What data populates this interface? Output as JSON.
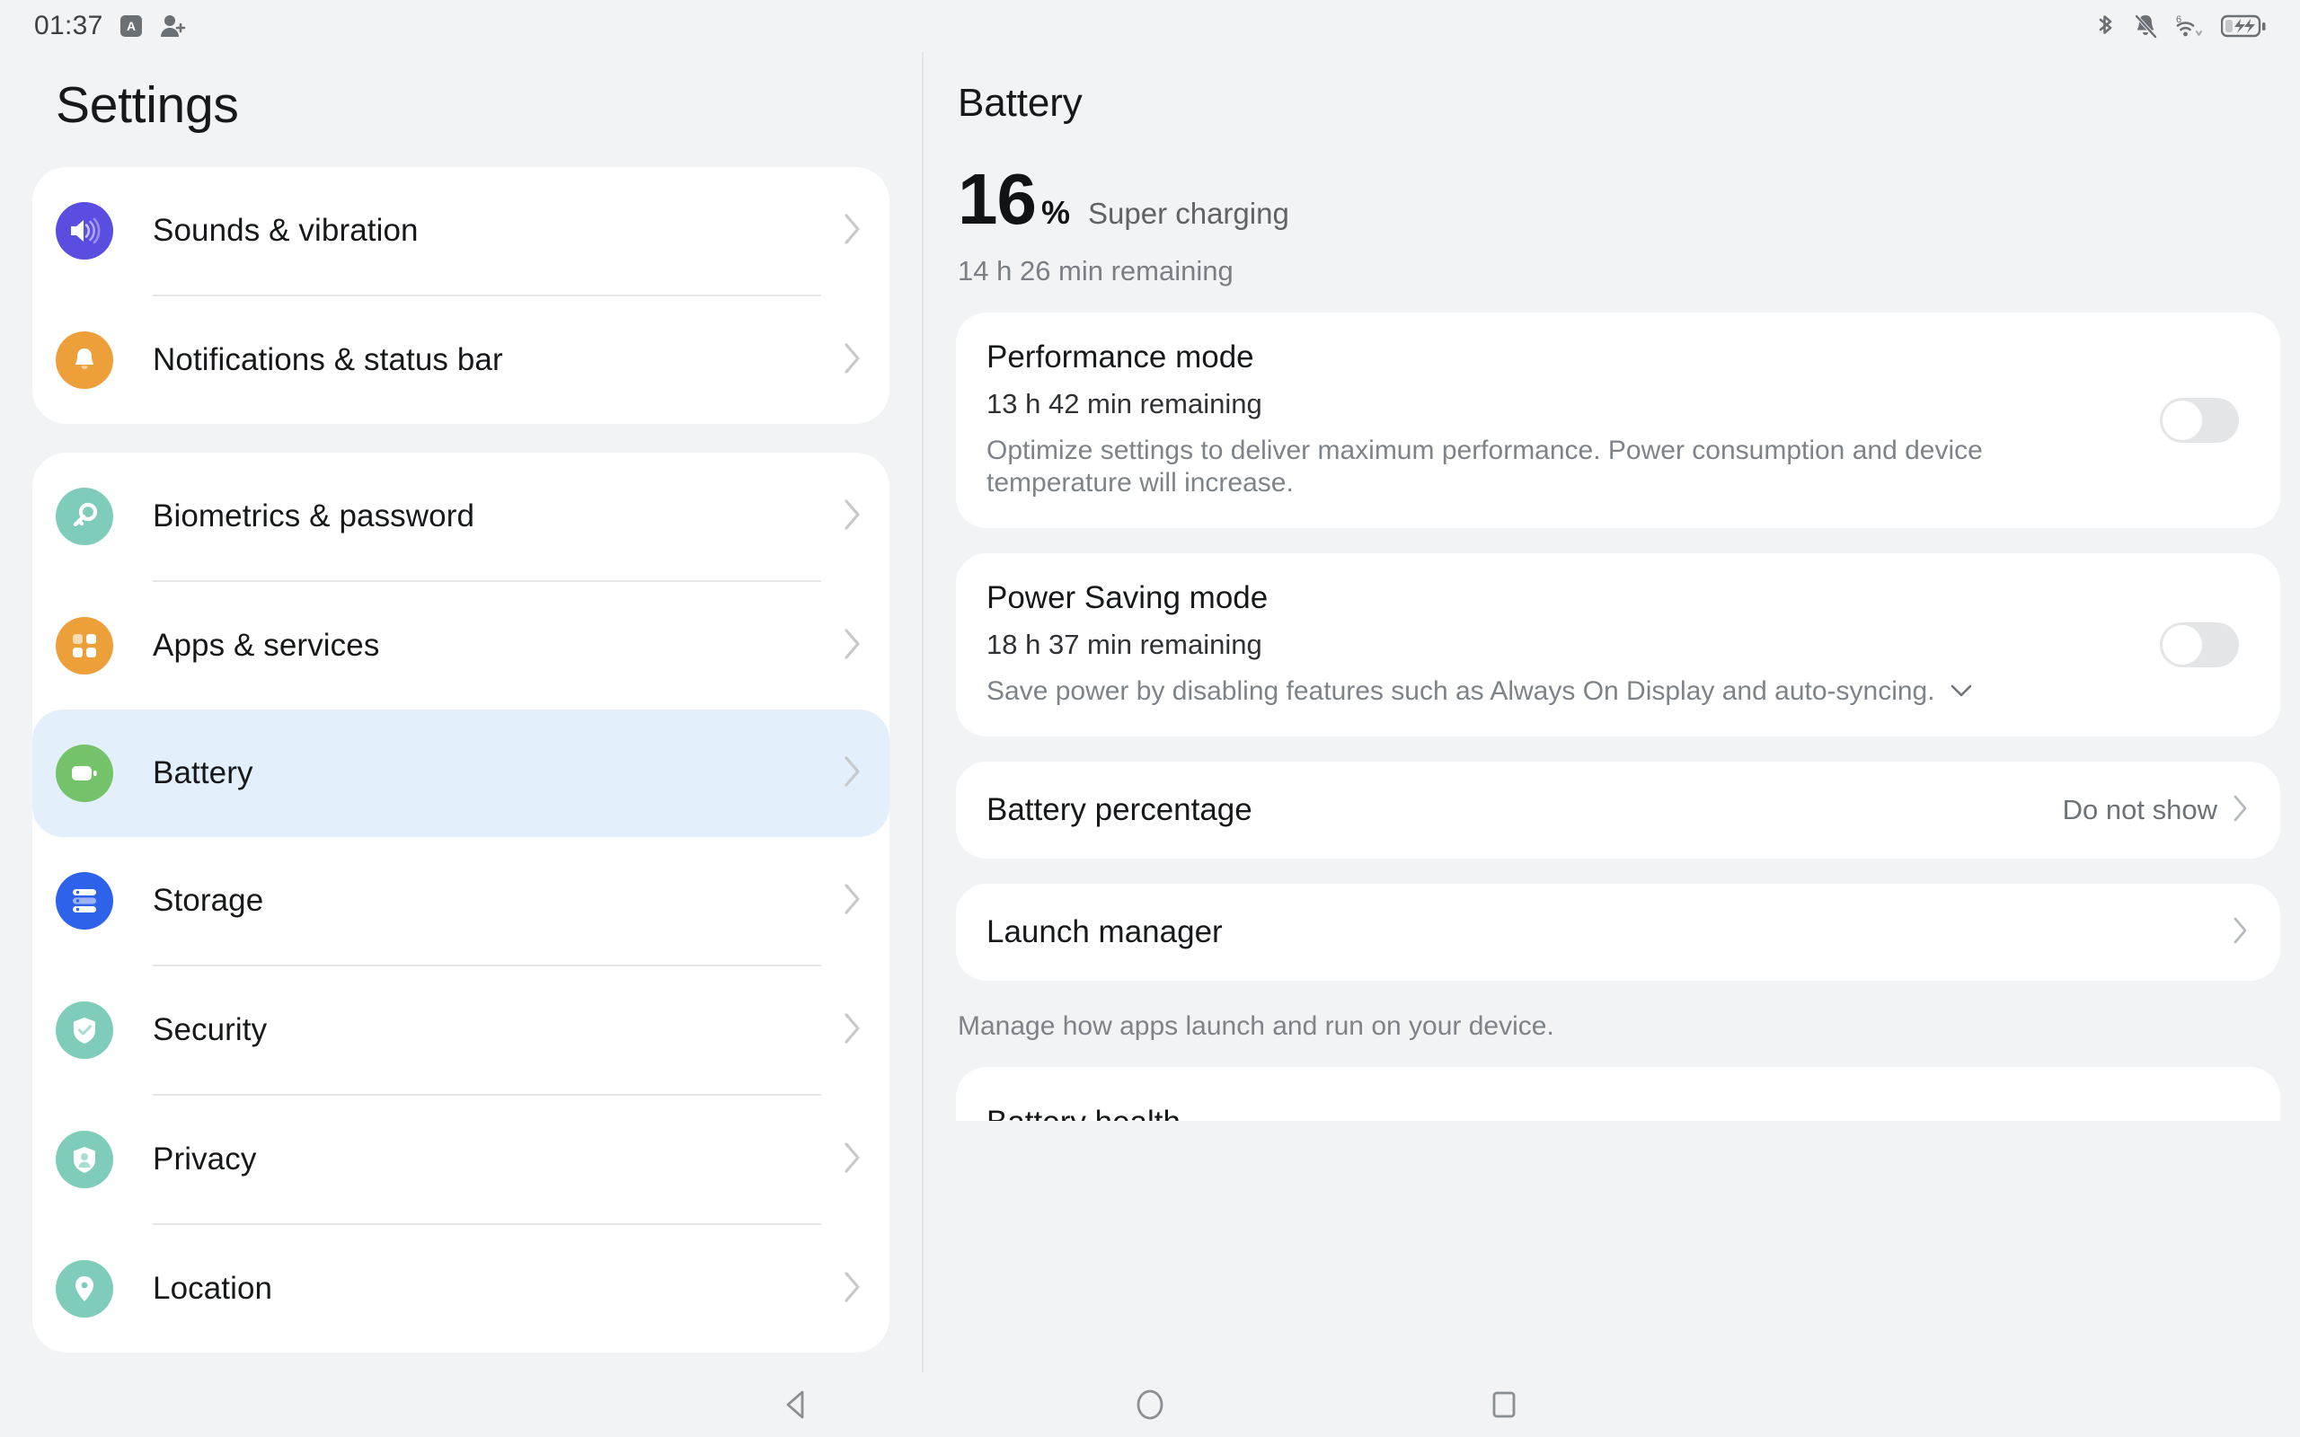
{
  "status_bar": {
    "clock": "01:37",
    "left_icons": [
      "text-selection-icon",
      "add-person-icon"
    ],
    "right_icons": [
      "bluetooth-icon",
      "notifications-muted-icon",
      "wifi-6-icon",
      "battery-charging-icon"
    ],
    "wifi_label": "6"
  },
  "sidebar": {
    "title": "Settings",
    "groups": [
      {
        "items": [
          {
            "label": "Sounds & vibration",
            "icon": "speaker-icon",
            "color": "#5a4ee0",
            "selected": false
          },
          {
            "label": "Notifications & status bar",
            "icon": "bell-icon",
            "color": "#eda03a",
            "selected": false
          }
        ]
      },
      {
        "items": [
          {
            "label": "Biometrics & password",
            "icon": "key-icon",
            "color": "#7fccbb",
            "selected": false
          },
          {
            "label": "Apps & services",
            "icon": "apps-grid-icon",
            "color": "#eda03a",
            "selected": false
          },
          {
            "label": "Battery",
            "icon": "battery-icon",
            "color": "#74c269",
            "selected": true
          },
          {
            "label": "Storage",
            "icon": "storage-icon",
            "color": "#2f62ea",
            "selected": false
          },
          {
            "label": "Security",
            "icon": "shield-check-icon",
            "color": "#7fccbb",
            "selected": false
          },
          {
            "label": "Privacy",
            "icon": "shield-person-icon",
            "color": "#7fccbb",
            "selected": false
          },
          {
            "label": "Location",
            "icon": "location-pin-icon",
            "color": "#7fccbb",
            "selected": false
          }
        ]
      }
    ]
  },
  "main": {
    "page_title": "Battery",
    "summary": {
      "percent": "16",
      "percent_symbol": "%",
      "charge_state": "Super charging",
      "time_remaining": "14 h 26 min remaining"
    },
    "performance_mode": {
      "title": "Performance mode",
      "remaining": "13 h 42 min remaining",
      "description": "Optimize settings to deliver maximum performance. Power consumption and device temperature will increase.",
      "toggle_on": false
    },
    "power_saving_mode": {
      "title": "Power Saving mode",
      "remaining": "18 h 37 min remaining",
      "description": "Save power by disabling features such as Always On Display and auto-syncing.",
      "toggle_on": false,
      "expand_icon": "chevron-down-icon"
    },
    "battery_percentage": {
      "title": "Battery percentage",
      "value": "Do not show"
    },
    "launch_manager": {
      "title": "Launch manager",
      "note": "Manage how apps launch and run on your device."
    },
    "battery_health": {
      "title": "Battery health"
    }
  },
  "navbar": {
    "back": "back-triangle-icon",
    "home": "home-circle-icon",
    "recents": "recents-square-icon"
  },
  "colors": {
    "page_bg": "#f1f3f4",
    "card_bg": "#ffffff",
    "selected_row": "#e3effa",
    "toggle_off": "#e4e5e6"
  }
}
